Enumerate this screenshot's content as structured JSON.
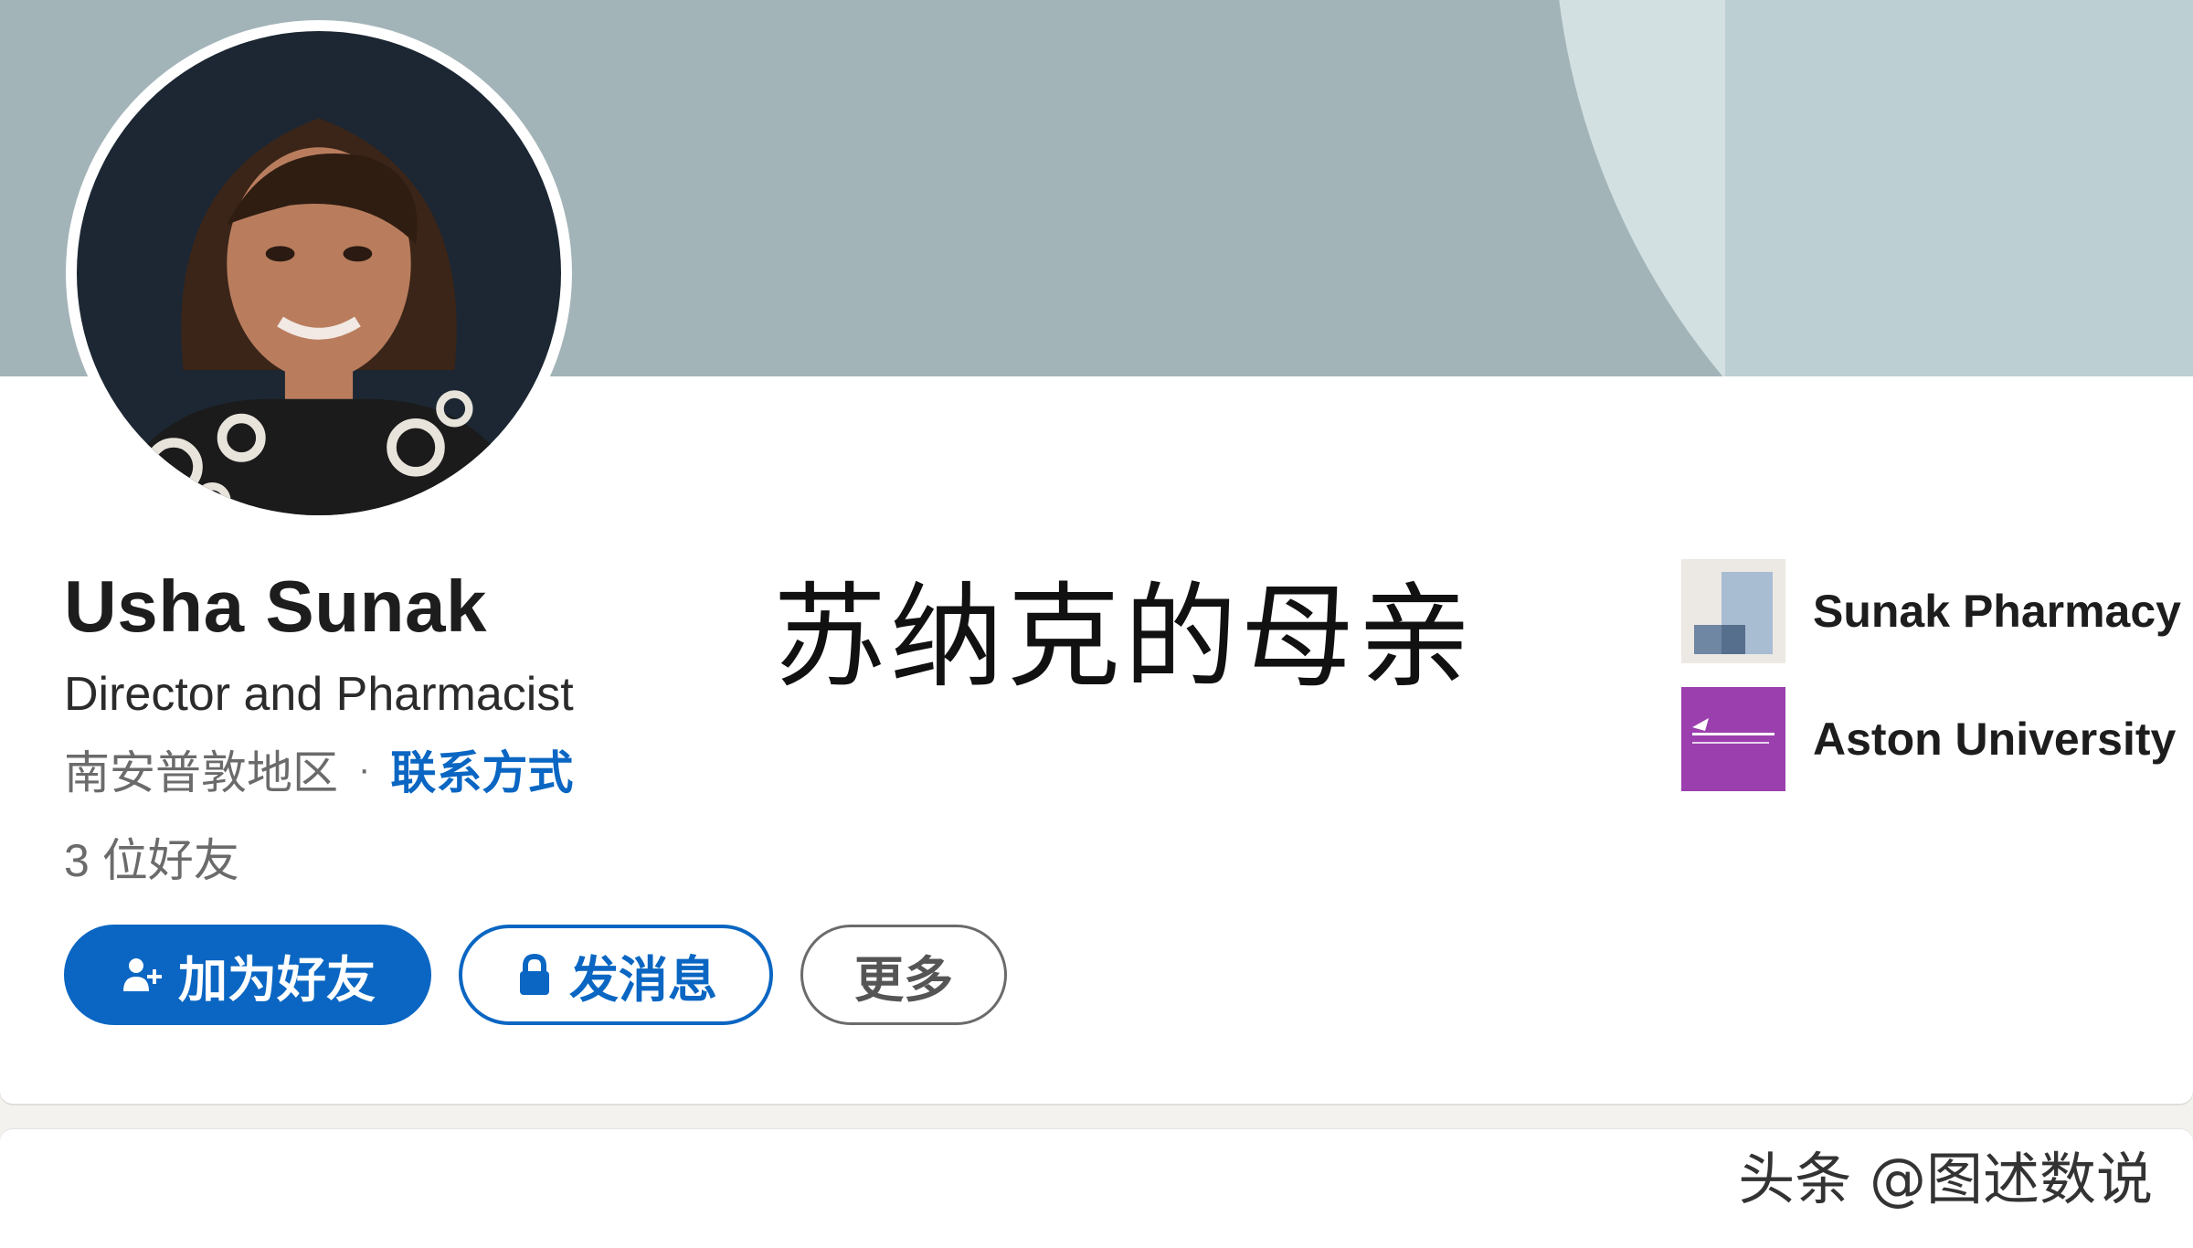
{
  "profile": {
    "name": "Usha Sunak",
    "headline": "Director and Pharmacist",
    "location": "南安普敦地区",
    "separator": "·",
    "contact_info": "联系方式",
    "connections": "3 位好友"
  },
  "actions": {
    "connect_label": "加为好友",
    "message_label": "发消息",
    "more_label": "更多"
  },
  "organizations": [
    {
      "name": "Sunak Pharmacy",
      "logo": "sunak-pharmacy-logo"
    },
    {
      "name": "Aston University",
      "logo": "aston-university-logo"
    }
  ],
  "overlay": {
    "caption": "苏纳克的母亲",
    "watermark": "头条 @图述数说"
  },
  "colors": {
    "accent": "#0a66c2",
    "banner": "#a3b4b9",
    "aston_purple": "#9b3fae"
  },
  "icons": {
    "connect": "add-person-icon",
    "message": "lock-icon"
  }
}
